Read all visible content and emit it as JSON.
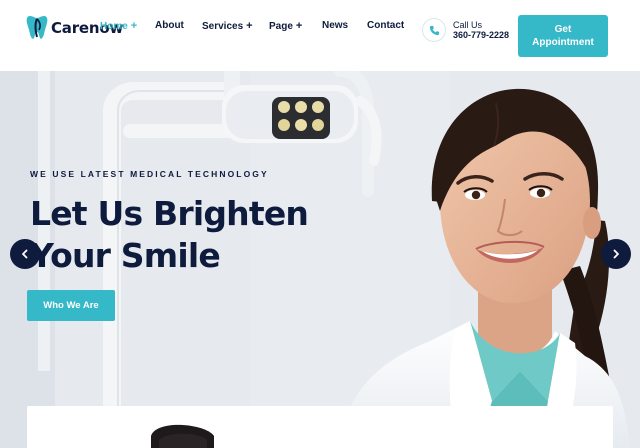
{
  "brand": {
    "name": "Carenow",
    "accent": "#35b8c8",
    "dark": "#0e1b3d"
  },
  "nav": {
    "items": [
      {
        "label": "Home",
        "has_plus": true,
        "active": true
      },
      {
        "label": "About",
        "has_plus": false,
        "active": false
      },
      {
        "label": "Services",
        "has_plus": true,
        "active": false
      },
      {
        "label": "Page",
        "has_plus": true,
        "active": false
      },
      {
        "label": "News",
        "has_plus": false,
        "active": false
      },
      {
        "label": "Contact",
        "has_plus": false,
        "active": false
      }
    ],
    "plus_symbol": "+"
  },
  "call": {
    "icon": "phone-icon",
    "label": "Call Us",
    "number": "360-779-2228"
  },
  "cta": {
    "appointment_label": "Get Appointment"
  },
  "hero": {
    "eyebrow": "WE USE LATEST MEDICAL TECHNOLOGY",
    "headline_line1": "Let Us Brighten",
    "headline_line2": "Your Smile",
    "button_label": "Who We Are",
    "prev_icon": "chevron-left-icon",
    "next_icon": "chevron-right-icon"
  }
}
